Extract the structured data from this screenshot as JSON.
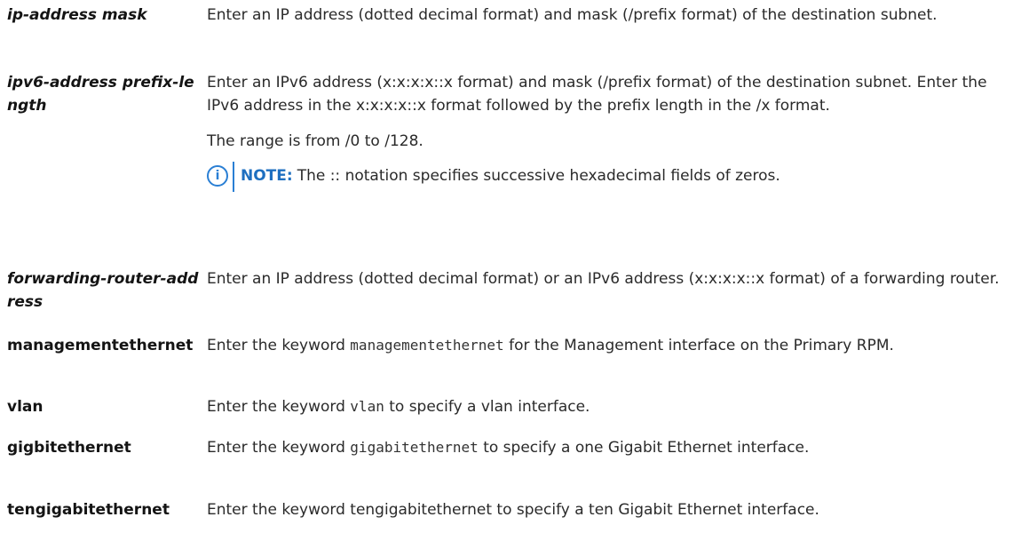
{
  "rows": [
    {
      "term": "ip-address mask",
      "italic": true,
      "desc": "Enter an IP address (dotted decimal format) and mask (/prefix format) of the destination subnet."
    },
    {
      "term": "ipv6-address prefix-length",
      "italic": true,
      "desc": "Enter an IPv6 address (x:x:x:x::x format) and mask (/prefix format) of the destination subnet. Enter the IPv6 address in the x:x:x:x::x format followed by the prefix length in the /x format.",
      "extra": "The range is from /0 to /128.",
      "note": {
        "icon": "info-icon",
        "label": "NOTE:",
        "text": "The :: notation specifies successive hexadecimal fields of zeros."
      }
    },
    {
      "term": "forwarding-router-address",
      "italic": true,
      "desc": "Enter an IP address (dotted decimal format) or an IPv6 address (x:x:x:x::x format) of a forwarding router."
    },
    {
      "term": "managementethernet",
      "italic": false,
      "desc_pre": "Enter the keyword ",
      "desc_code": "managementethernet",
      "desc_post": " for the Management interface on the Primary RPM."
    },
    {
      "term": "vlan",
      "italic": false,
      "desc_pre": "Enter the keyword ",
      "desc_code": "vlan",
      "desc_post": " to specify a vlan interface."
    },
    {
      "term": "gigbitethernet",
      "italic": false,
      "desc_pre": "Enter the keyword ",
      "desc_code": "gigabitethernet",
      "desc_post": " to specify a one Gigabit Ethernet interface."
    },
    {
      "term": "tengigabitethernet",
      "italic": false,
      "desc": "Enter the keyword tengigabitethernet to specify a ten Gigabit Ethernet interface."
    }
  ],
  "colors": {
    "note_accent": "#2a7fd4",
    "term_text": "#141414",
    "body_text": "#2a2a2a"
  }
}
